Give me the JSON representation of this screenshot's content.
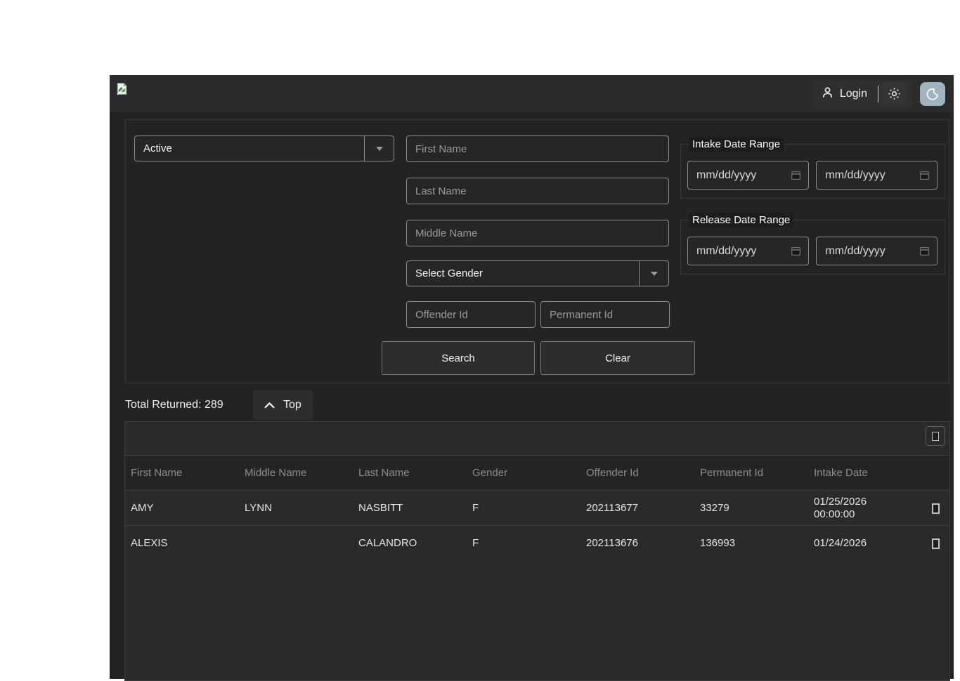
{
  "header": {
    "logo_icon": "broken-image-icon",
    "login_label": "Login",
    "theme": {
      "light_icon": "sun-icon",
      "dark_icon": "moon-icon",
      "dark_active_bg": "#a0b4c0"
    }
  },
  "search": {
    "status_value": "Active",
    "first_name_placeholder": "First Name",
    "last_name_placeholder": "Last Name",
    "middle_name_placeholder": "Middle Name",
    "gender_value": "Select Gender",
    "offender_id_placeholder": "Offender Id",
    "permanent_id_placeholder": "Permanent Id",
    "intake_date_range_label": "Intake Date Range",
    "release_date_range_label": "Release Date Range",
    "date_placeholder": "mm/dd/yyyy",
    "search_label": "Search",
    "clear_label": "Clear"
  },
  "results": {
    "total_label": "Total Returned: 289",
    "top_label": "Top",
    "table": {
      "columns": [
        "First Name",
        "Middle Name",
        "Last Name",
        "Gender",
        "Offender Id",
        "Permanent Id",
        "Intake Date"
      ],
      "rows": [
        {
          "first_name": "AMY",
          "middle_name": "LYNN",
          "last_name": "NASBITT",
          "gender": "F",
          "offender_id": "202113677",
          "permanent_id": "33279",
          "intake_date": "01/25/2026\n00:00:00"
        },
        {
          "first_name": "ALEXIS",
          "middle_name": "",
          "last_name": "CALANDRO",
          "gender": "F",
          "offender_id": "202113676",
          "permanent_id": "136993",
          "intake_date": "01/24/2026"
        }
      ]
    }
  }
}
